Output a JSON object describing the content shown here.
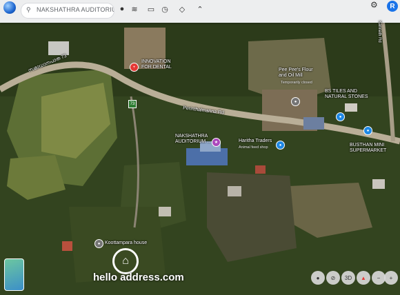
{
  "search": {
    "value": "NAKSHATHRA AUDITORIUM (KAR"
  },
  "user": {
    "initial": "R"
  },
  "roads": {
    "left_road": "സമാധാനപാത 73",
    "main_road": "Perinthalmanna Rd",
    "right_road": "Kannath Rd",
    "shield": "73"
  },
  "places": {
    "innovation": "INNOVATION\nFOR DENTAL",
    "peepees": "Pee Pee's Flour\nand Oil Mill",
    "peepees_sub": "Temporarily closed",
    "bstiles": "BS TILES AND\nNATURAL STONES",
    "nakshathra": "NAKSHATHRA\nAUDITORIUM ...",
    "haritha": "Haritha Traders",
    "haritha_sub": "Animal feed shop",
    "busthan": "BUSTHAN MINI\nSUPERMARKET",
    "koottampara": "Koottampara house"
  },
  "watermark": {
    "text": "hello  address.com"
  },
  "controls": {
    "three_d": "3D"
  }
}
